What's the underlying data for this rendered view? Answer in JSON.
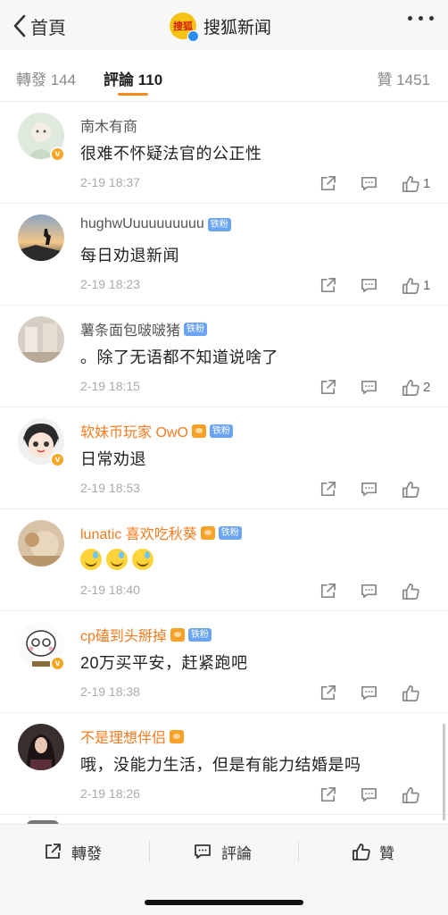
{
  "nav": {
    "back_label": "首頁",
    "title": "搜狐新闻",
    "logo_text": "搜狐"
  },
  "tabs": {
    "repost": "轉發 144",
    "comment": "評論 110",
    "like": "贊 1451"
  },
  "badge_label": "铁粉",
  "comments": [
    {
      "username": "南木有商",
      "text": "很难不怀疑法官的公正性",
      "time": "2-19 18:37",
      "likes": "1"
    },
    {
      "username": "hughwUuuuuuuuuu",
      "text": "每日劝退新闻",
      "time": "2-19 18:23",
      "likes": "1"
    },
    {
      "username": "薯条面包啵啵猪",
      "text": "。除了无语都不知道说啥了",
      "time": "2-19 18:15",
      "likes": "2"
    },
    {
      "username": "软妹币玩家 OwO",
      "text": "日常劝退",
      "time": "2-19 18:53",
      "likes": ""
    },
    {
      "username": "lunatic 喜欢吃秋葵",
      "text": "",
      "time": "2-19 18:40",
      "likes": ""
    },
    {
      "username": "cp磕到头掰掉",
      "text": "20万买平安，赶紧跑吧",
      "time": "2-19 18:38",
      "likes": ""
    },
    {
      "username": "不是理想伴侣",
      "text": "哦，没能力生活，但是有能力结婚是吗",
      "time": "2-19 18:26",
      "likes": ""
    }
  ],
  "bottom": {
    "repost": "轉發",
    "comment": "評論",
    "like": "贊"
  },
  "colors": {
    "accent": "#f78a1d",
    "vip_name": "#f47c20",
    "fan_badge": "#6aa4f2",
    "verified": "#f5a623"
  }
}
